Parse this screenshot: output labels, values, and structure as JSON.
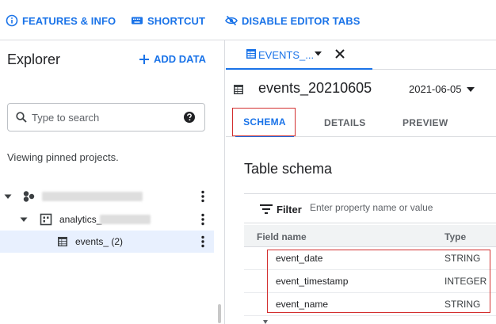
{
  "topbar": {
    "features_label": "FEATURES & INFO",
    "shortcut_label": "SHORTCUT",
    "disable_tabs_label": "DISABLE EDITOR TABS"
  },
  "explorer": {
    "title": "Explorer",
    "add_data_label": "ADD DATA",
    "search_placeholder": "Type to search",
    "pinned_text": "Viewing pinned projects.",
    "tree": {
      "dataset_label": "analytics_",
      "table_label": "events_ (2)"
    }
  },
  "editor": {
    "tab_label": "EVENTS_...",
    "table_name": "events_20210605",
    "date_value": "2021-06-05",
    "subtabs": [
      "SCHEMA",
      "DETAILS",
      "PREVIEW"
    ],
    "schema_title": "Table schema",
    "filter_label": "Filter",
    "filter_placeholder": "Enter property name or value",
    "columns": [
      "Field name",
      "Type"
    ],
    "rows": [
      {
        "field": "event_date",
        "type": "STRING"
      },
      {
        "field": "event_timestamp",
        "type": "INTEGER"
      },
      {
        "field": "event_name",
        "type": "STRING"
      }
    ]
  },
  "colors": {
    "accent": "#1a73e8",
    "highlight": "#d32f2f",
    "selected_row": "#e8f0fe"
  },
  "icons": [
    "info-icon",
    "keyboard-icon",
    "eye-off-icon",
    "plus-icon",
    "search-icon",
    "help-icon",
    "caret-down-icon",
    "project-icon",
    "dataset-icon",
    "table-icon",
    "more-vert-icon",
    "close-icon",
    "dropdown-icon",
    "filter-icon"
  ]
}
